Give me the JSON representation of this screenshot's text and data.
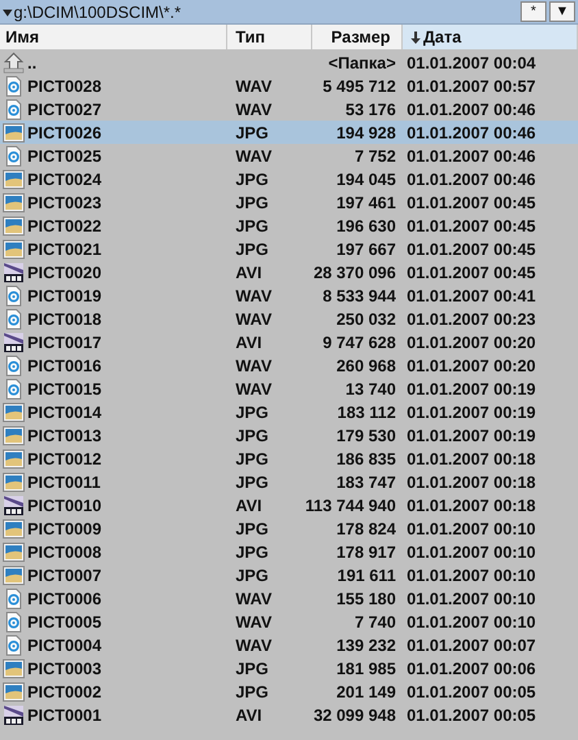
{
  "path_bar": {
    "path": "g:\\DCIM\\100DSCIM\\*.*",
    "buttons": [
      "*",
      "▼"
    ]
  },
  "columns": [
    {
      "label": "Имя",
      "sorted": false
    },
    {
      "label": "Тип",
      "sorted": false
    },
    {
      "label": "Размер",
      "sorted": false
    },
    {
      "label": "Дата",
      "sorted": true
    }
  ],
  "rows": [
    {
      "kind": "up",
      "name": "..",
      "size": "<Папка>",
      "date": "01.01.2007 00:04",
      "selected": false
    },
    {
      "kind": "wav",
      "name": "PICT0028",
      "type": "WAV",
      "size": "5 495 712",
      "date": "01.01.2007 00:57",
      "selected": false
    },
    {
      "kind": "wav",
      "name": "PICT0027",
      "type": "WAV",
      "size": "53 176",
      "date": "01.01.2007 00:46",
      "selected": false
    },
    {
      "kind": "jpg",
      "name": "PICT0026",
      "type": "JPG",
      "size": "194 928",
      "date": "01.01.2007 00:46",
      "selected": true
    },
    {
      "kind": "wav",
      "name": "PICT0025",
      "type": "WAV",
      "size": "7 752",
      "date": "01.01.2007 00:46",
      "selected": false
    },
    {
      "kind": "jpg",
      "name": "PICT0024",
      "type": "JPG",
      "size": "194 045",
      "date": "01.01.2007 00:46",
      "selected": false
    },
    {
      "kind": "jpg",
      "name": "PICT0023",
      "type": "JPG",
      "size": "197 461",
      "date": "01.01.2007 00:45",
      "selected": false
    },
    {
      "kind": "jpg",
      "name": "PICT0022",
      "type": "JPG",
      "size": "196 630",
      "date": "01.01.2007 00:45",
      "selected": false
    },
    {
      "kind": "jpg",
      "name": "PICT0021",
      "type": "JPG",
      "size": "197 667",
      "date": "01.01.2007 00:45",
      "selected": false
    },
    {
      "kind": "avi",
      "name": "PICT0020",
      "type": "AVI",
      "size": "28 370 096",
      "date": "01.01.2007 00:45",
      "selected": false
    },
    {
      "kind": "wav",
      "name": "PICT0019",
      "type": "WAV",
      "size": "8 533 944",
      "date": "01.01.2007 00:41",
      "selected": false
    },
    {
      "kind": "wav",
      "name": "PICT0018",
      "type": "WAV",
      "size": "250 032",
      "date": "01.01.2007 00:23",
      "selected": false
    },
    {
      "kind": "avi",
      "name": "PICT0017",
      "type": "AVI",
      "size": "9 747 628",
      "date": "01.01.2007 00:20",
      "selected": false
    },
    {
      "kind": "wav",
      "name": "PICT0016",
      "type": "WAV",
      "size": "260 968",
      "date": "01.01.2007 00:20",
      "selected": false
    },
    {
      "kind": "wav",
      "name": "PICT0015",
      "type": "WAV",
      "size": "13 740",
      "date": "01.01.2007 00:19",
      "selected": false
    },
    {
      "kind": "jpg",
      "name": "PICT0014",
      "type": "JPG",
      "size": "183 112",
      "date": "01.01.2007 00:19",
      "selected": false
    },
    {
      "kind": "jpg",
      "name": "PICT0013",
      "type": "JPG",
      "size": "179 530",
      "date": "01.01.2007 00:19",
      "selected": false
    },
    {
      "kind": "jpg",
      "name": "PICT0012",
      "type": "JPG",
      "size": "186 835",
      "date": "01.01.2007 00:18",
      "selected": false
    },
    {
      "kind": "jpg",
      "name": "PICT0011",
      "type": "JPG",
      "size": "183 747",
      "date": "01.01.2007 00:18",
      "selected": false
    },
    {
      "kind": "avi",
      "name": "PICT0010",
      "type": "AVI",
      "size": "113 744 940",
      "date": "01.01.2007 00:18",
      "selected": false
    },
    {
      "kind": "jpg",
      "name": "PICT0009",
      "type": "JPG",
      "size": "178 824",
      "date": "01.01.2007 00:10",
      "selected": false
    },
    {
      "kind": "jpg",
      "name": "PICT0008",
      "type": "JPG",
      "size": "178 917",
      "date": "01.01.2007 00:10",
      "selected": false
    },
    {
      "kind": "jpg",
      "name": "PICT0007",
      "type": "JPG",
      "size": "191 611",
      "date": "01.01.2007 00:10",
      "selected": false
    },
    {
      "kind": "wav",
      "name": "PICT0006",
      "type": "WAV",
      "size": "155 180",
      "date": "01.01.2007 00:10",
      "selected": false
    },
    {
      "kind": "wav",
      "name": "PICT0005",
      "type": "WAV",
      "size": "7 740",
      "date": "01.01.2007 00:10",
      "selected": false
    },
    {
      "kind": "wav",
      "name": "PICT0004",
      "type": "WAV",
      "size": "139 232",
      "date": "01.01.2007 00:07",
      "selected": false
    },
    {
      "kind": "jpg",
      "name": "PICT0003",
      "type": "JPG",
      "size": "181 985",
      "date": "01.01.2007 00:06",
      "selected": false
    },
    {
      "kind": "jpg",
      "name": "PICT0002",
      "type": "JPG",
      "size": "201 149",
      "date": "01.01.2007 00:05",
      "selected": false
    },
    {
      "kind": "avi",
      "name": "PICT0001",
      "type": "AVI",
      "size": "32 099 948",
      "date": "01.01.2007 00:05",
      "selected": false
    }
  ]
}
